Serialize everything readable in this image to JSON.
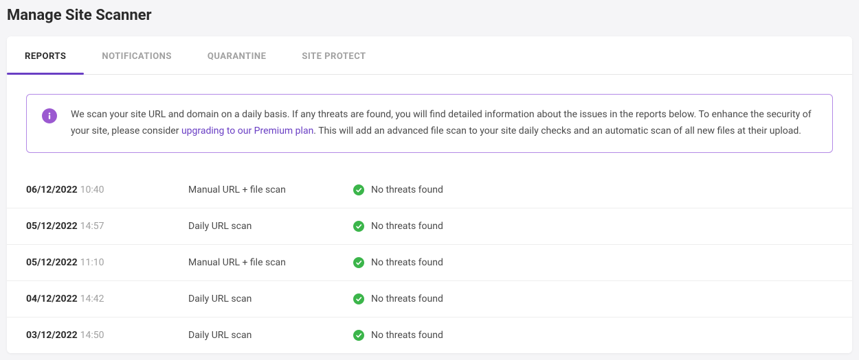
{
  "page": {
    "title": "Manage Site Scanner"
  },
  "tabs": [
    {
      "label": "REPORTS",
      "active": true,
      "name": "tab-reports"
    },
    {
      "label": "NOTIFICATIONS",
      "active": false,
      "name": "tab-notifications"
    },
    {
      "label": "QUARANTINE",
      "active": false,
      "name": "tab-quarantine"
    },
    {
      "label": "SITE PROTECT",
      "active": false,
      "name": "tab-site-protect"
    }
  ],
  "banner": {
    "text_before": "We scan your site URL and domain on a daily basis. If any threats are found, you will find detailed information about the issues in the reports below. To enhance the security of your site, please consider ",
    "link_text": "upgrading to our Premium plan",
    "text_after": ". This will add an advanced file scan to your site daily checks and an automatic scan of all new files at their upload."
  },
  "rows": [
    {
      "date": "06/12/2022",
      "time": "10:40",
      "type": "Manual URL + file scan",
      "status": "No threats found"
    },
    {
      "date": "05/12/2022",
      "time": "14:57",
      "type": "Daily URL scan",
      "status": "No threats found"
    },
    {
      "date": "05/12/2022",
      "time": "11:10",
      "type": "Manual URL + file scan",
      "status": "No threats found"
    },
    {
      "date": "04/12/2022",
      "time": "14:42",
      "type": "Daily URL scan",
      "status": "No threats found"
    },
    {
      "date": "03/12/2022",
      "time": "14:50",
      "type": "Daily URL scan",
      "status": "No threats found"
    }
  ]
}
